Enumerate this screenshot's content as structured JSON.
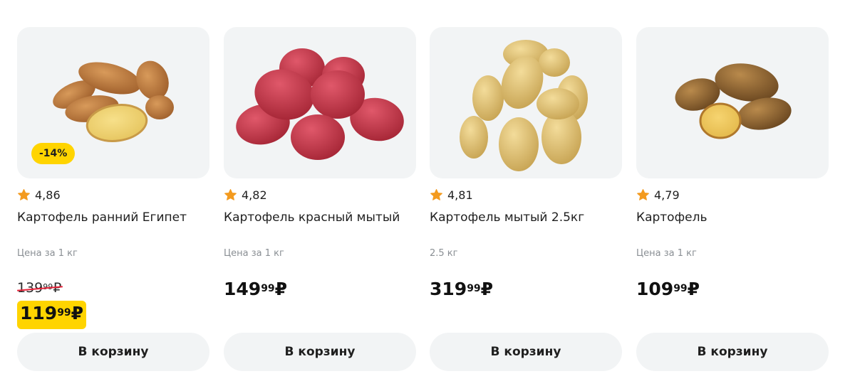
{
  "products": [
    {
      "rating": "4,86",
      "title": "Картофель ранний Египет",
      "unit": "Цена за 1 кг",
      "discount": "-14%",
      "old_price_main": "139",
      "old_price_cents": "99",
      "old_price_currency": "₽",
      "price_main": "119",
      "price_cents": "99",
      "price_currency": "₽",
      "button": "В корзину",
      "image": "potato-icon"
    },
    {
      "rating": "4,82",
      "title": "Картофель красный мытый",
      "unit": "Цена за 1 кг",
      "price_main": "149",
      "price_cents": "99",
      "price_currency": "₽",
      "button": "В корзину",
      "image": "potato-icon"
    },
    {
      "rating": "4,81",
      "title": "Картофель мытый 2.5кг",
      "unit": "2.5 кг",
      "price_main": "319",
      "price_cents": "99",
      "price_currency": "₽",
      "button": "В корзину",
      "image": "potato-icon"
    },
    {
      "rating": "4,79",
      "title": "Картофель",
      "unit": "Цена за 1 кг",
      "price_main": "109",
      "price_cents": "99",
      "price_currency": "₽",
      "button": "В корзину",
      "image": "potato-icon"
    }
  ],
  "colors": {
    "accent_yellow": "#ffd400",
    "star": "#f39a1e",
    "card_bg": "#f2f4f5",
    "strike": "#e8233a"
  }
}
